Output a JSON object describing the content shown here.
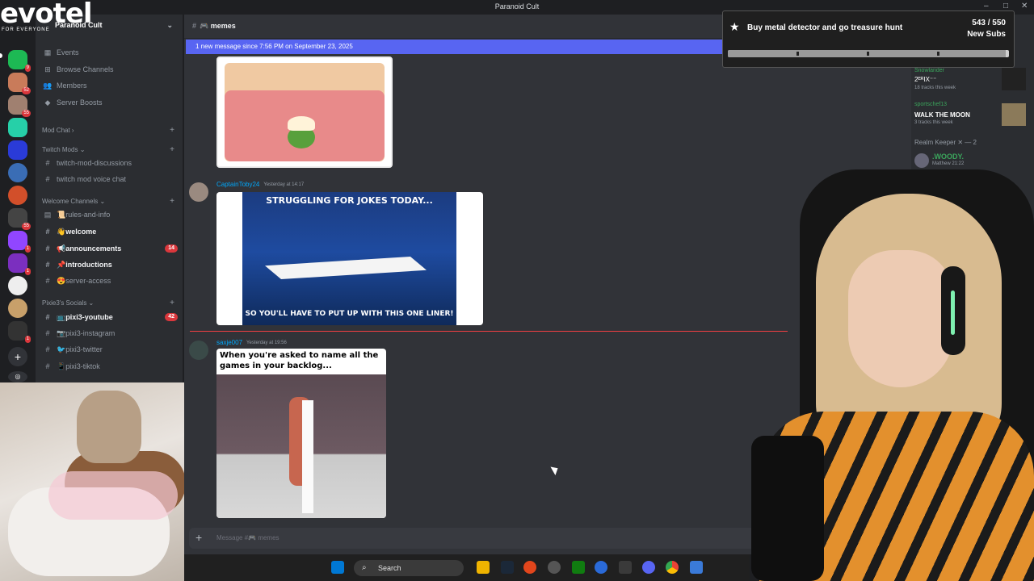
{
  "window": {
    "title": "Paranoid Cult"
  },
  "logo": {
    "text": "evotel",
    "sub": "FOR EVERYONE"
  },
  "server_badges": [
    "9",
    "52",
    "55",
    "1",
    "55",
    "1",
    "1",
    "1"
  ],
  "guild": {
    "name": "Paranoid Cult"
  },
  "sidebar": {
    "top_items": [
      {
        "icon": "calendar-icon",
        "label": "Events"
      },
      {
        "icon": "browse-channels-icon",
        "label": "Browse Channels"
      },
      {
        "icon": "members-icon",
        "label": "Members"
      },
      {
        "icon": "boost-icon",
        "label": "Server Boosts"
      }
    ],
    "categories": [
      {
        "label": "Mod Chat",
        "channels": []
      },
      {
        "label": "Twitch Mods",
        "channels": [
          {
            "name": "twitch-mod-discussions",
            "bold": false,
            "count": ""
          },
          {
            "name": "twitch mod voice chat",
            "bold": false,
            "count": ""
          }
        ]
      },
      {
        "label": "Welcome Channels",
        "channels": [
          {
            "name": "📜rules-and-info",
            "bold": false,
            "count": ""
          },
          {
            "name": "👋welcome",
            "bold": true,
            "count": ""
          },
          {
            "name": "📢announcements",
            "bold": true,
            "count": "14"
          },
          {
            "name": "📌introductions",
            "bold": true,
            "count": ""
          },
          {
            "name": "😍server-access",
            "bold": false,
            "count": ""
          }
        ]
      },
      {
        "label": "Pixie3's Socials",
        "channels": [
          {
            "name": "📺pixi3-youtube",
            "bold": true,
            "count": "42"
          },
          {
            "name": "📷pixi3-instagram",
            "bold": false,
            "count": ""
          },
          {
            "name": "🐦pixi3-twitter",
            "bold": false,
            "count": ""
          },
          {
            "name": "📱pixi3-tiktok",
            "bold": false,
            "count": ""
          }
        ]
      }
    ]
  },
  "channel": {
    "name": "memes",
    "emoji": "🎮"
  },
  "new_messages_bar": "1 new message since 7:56 PM on September 23, 2025",
  "messages": [
    {
      "user": "CaptainToby24",
      "time": "Yesterday at 14:17",
      "meme_top": "STRUGGLING FOR JOKES TODAY...",
      "meme_bottom": "SO YOU'LL HAVE TO PUT UP WITH THIS ONE LINER!"
    },
    {
      "user": "saxje007",
      "time": "Yesterday at 19:56",
      "meme_top": "When you're asked to name all the games in your backlog..."
    }
  ],
  "composer": {
    "placeholder": "Message #🎮 memes"
  },
  "overlay": {
    "goal": "Buy metal detector and go treasure hunt",
    "current": 543,
    "target": 550,
    "count_text": "543 / 550",
    "label": "New Subs"
  },
  "right_panel": {
    "tracks": [
      {
        "user": "Snowlander",
        "title": "2ᴱᴿIX⁻⁻",
        "sub": "18 tracks this week"
      },
      {
        "user": "sportschef13",
        "title": "WALK THE MOON",
        "sub": "3 tracks this week"
      }
    ],
    "role": "Realm Keeper ✕ — 2",
    "member": {
      "name": ".WOODY.",
      "status": "Matthew 21:22"
    }
  },
  "taskbar": {
    "search_label": "Search"
  }
}
